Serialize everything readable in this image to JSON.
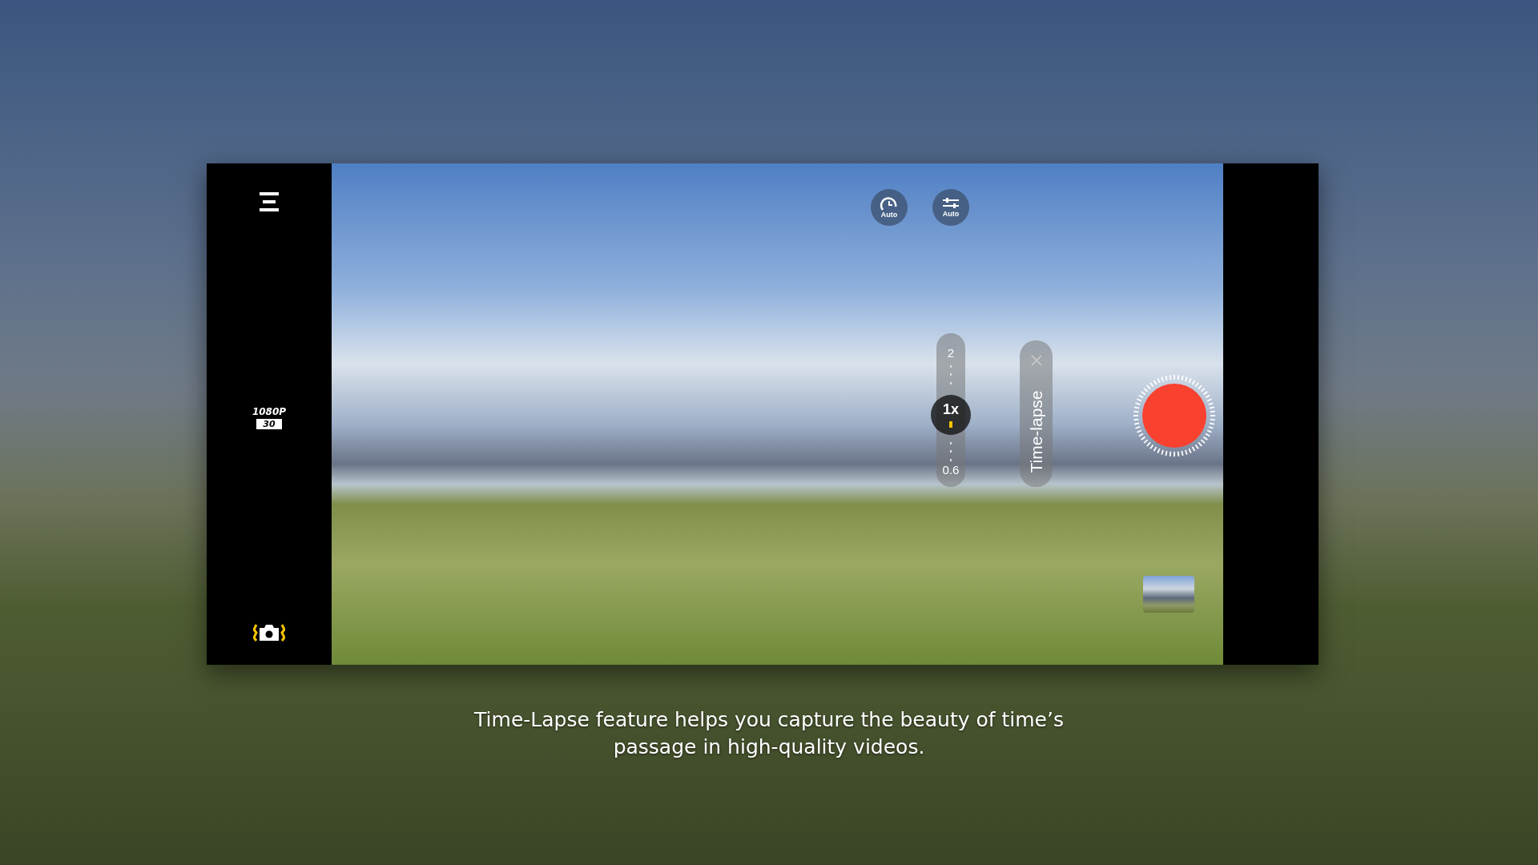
{
  "sidebar": {
    "resolution": "1080P",
    "frame_rate": "30"
  },
  "viewfinder": {
    "quick_buttons": [
      {
        "kind": "timer",
        "label": "Auto"
      },
      {
        "kind": "adjust",
        "label": "Auto"
      }
    ],
    "zoom": {
      "max": "2",
      "current": "1x",
      "min": "0.6",
      "level": 0.54
    },
    "mode_label": "Time-lapse"
  },
  "caption": "Time-Lapse feature helps you capture the beauty of time’s passage in high-quality videos."
}
